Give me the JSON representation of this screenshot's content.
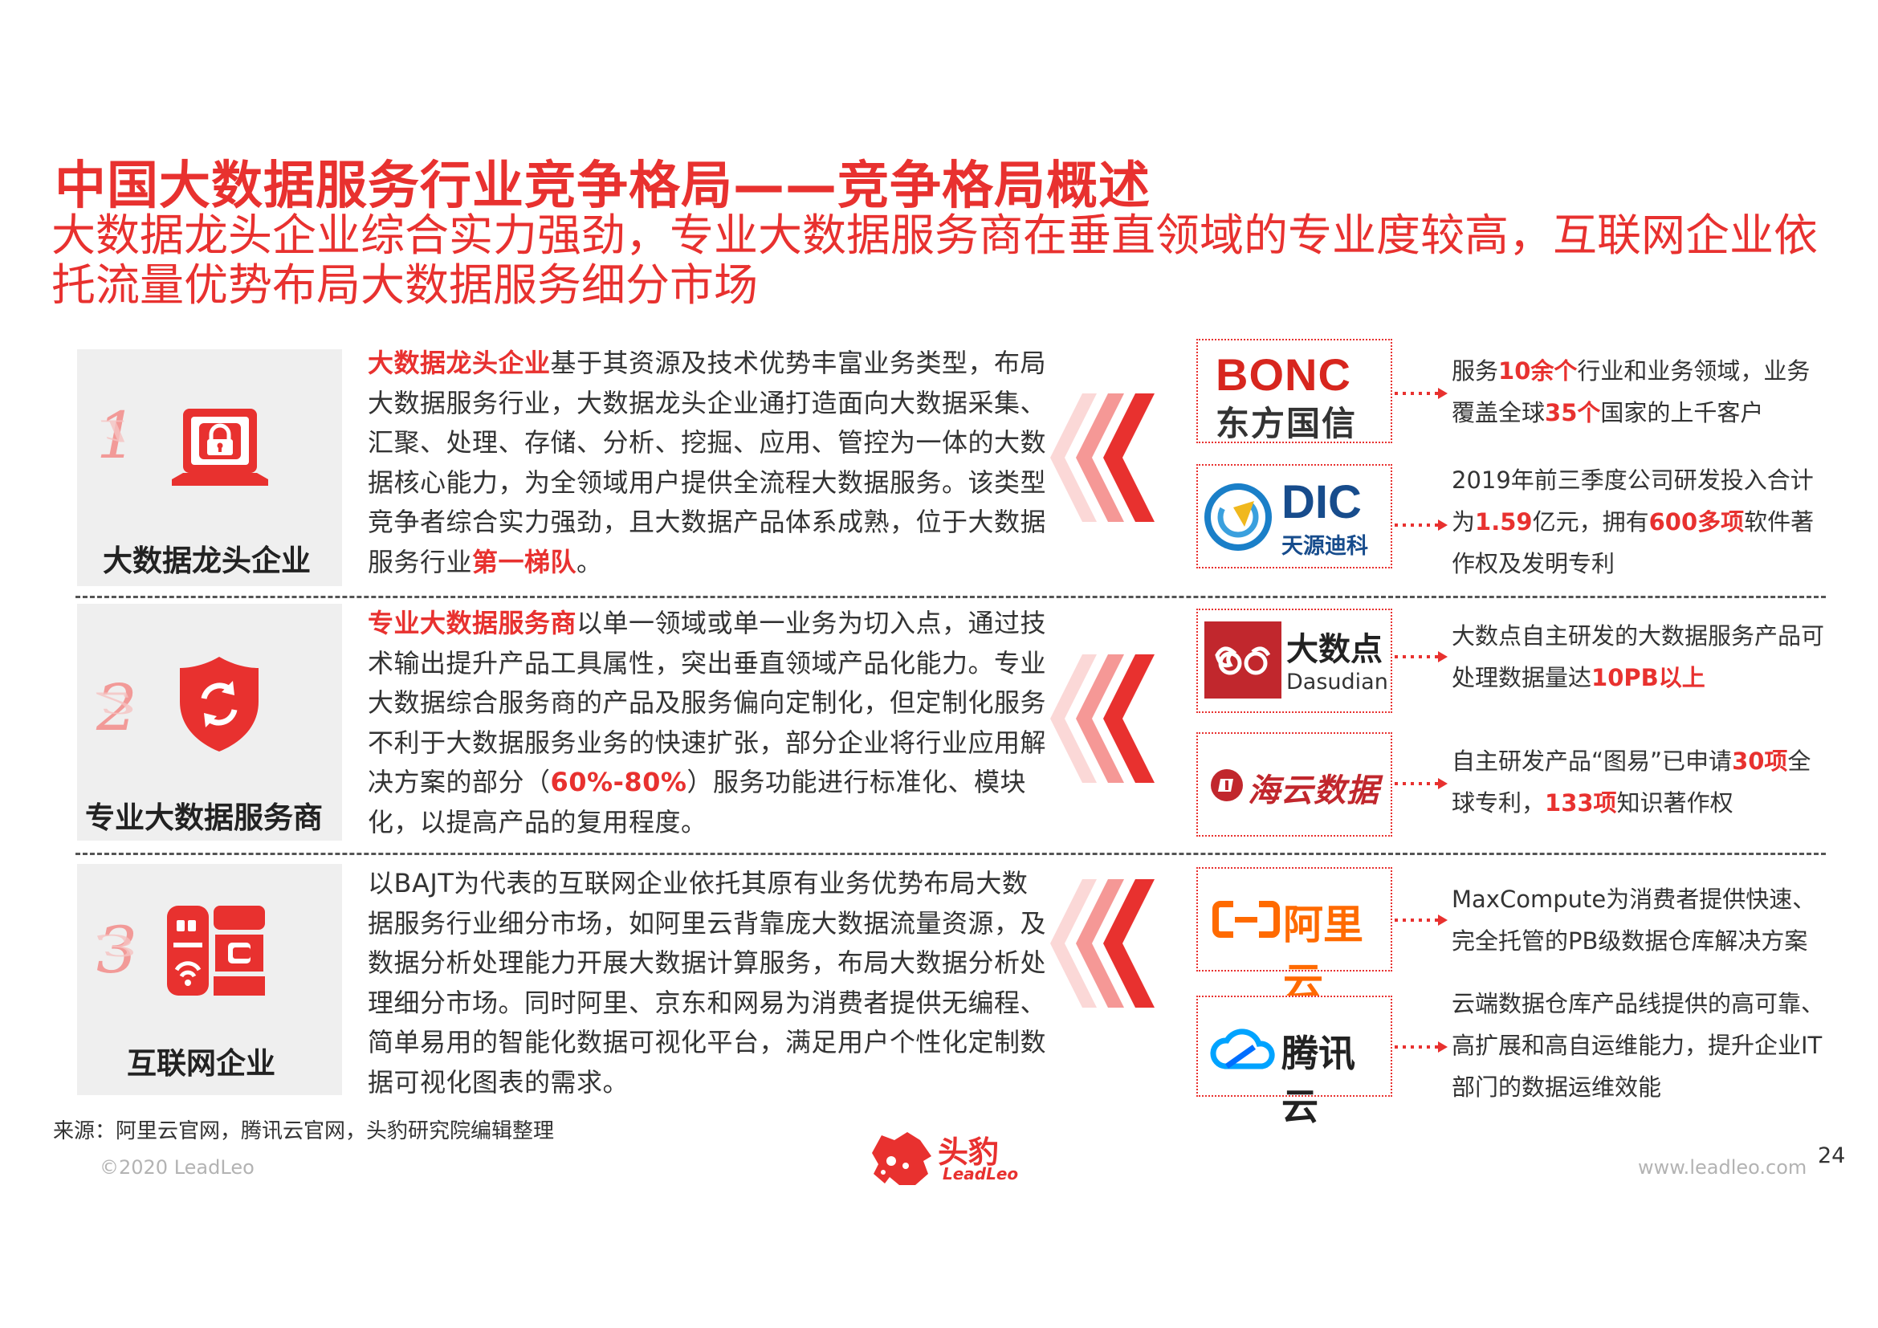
{
  "header": {
    "title": "中国大数据服务行业竞争格局——竞争格局概述",
    "subtitle": "大数据龙头企业综合实力强劲，专业大数据服务商在垂直领域的专业度较高，互联网企业依托流量优势布局大数据服务细分市场"
  },
  "colors": {
    "accent": "#e8312f",
    "panel": "#efefef",
    "muted": "#b3b3b3"
  },
  "sections": [
    {
      "number": "1",
      "icon": "laptop-lock-icon",
      "label": "大数据龙头企业",
      "desc": {
        "hl1": "大数据龙头企业",
        "t1": "基于其资源及技术优势丰富业务类型，布局大数据服务行业，大数据龙头企业通打造面向大数据采集、汇聚、处理、存储、分析、挖掘、应用、管控为一体的大数据核心能力，为全领域用户提供全流程大数据服务。该类型竞争者综合实力强劲，且大数据产品体系成熟，位于大数据服务行业",
        "hl2": "第一梯队",
        "t2": "。"
      },
      "companies": [
        {
          "logo_top": "BONC",
          "logo_bottom": "东方国信",
          "feature": {
            "a": "服务",
            "b": "10余个",
            "c": "行业和业务领域，业务覆盖全球",
            "d": "35个",
            "e": "国家的上千客户"
          }
        },
        {
          "logo_top": "DIC",
          "logo_bottom": "天源迪科",
          "feature": {
            "a": "2019年前三季度公司研发投入合计为",
            "b": "1.59",
            "c": "亿元，拥有",
            "d": "600多项",
            "e": "软件著作权及发明专利"
          }
        }
      ]
    },
    {
      "number": "2",
      "icon": "shield-sync-icon",
      "label": "专业大数据服务商",
      "desc": {
        "hl1": "专业大数据服务商",
        "t1": "以单一领域或单一业务为切入点，通过技术输出提升产品工具属性，突出垂直领域产品化能力。专业大数据综合服务商的产品及服务偏向定制化，但定制化服务不利于大数据服务业务的快速扩张，部分企业将行业应用解决方案的部分（",
        "hl2": "60%-80%",
        "t2": "）服务功能进行标准化、模块化，以提高产品的复用程度。"
      },
      "companies": [
        {
          "logo_top": "大数点",
          "logo_bottom": "Dasudian",
          "feature": {
            "a": "大数点自主研发的大数据服务产品可处理数据量达",
            "b": "10PB以上",
            "c": "",
            "d": "",
            "e": ""
          }
        },
        {
          "logo_top": "海云数据",
          "logo_bottom": "",
          "feature": {
            "a": "自主研发产品“图易”已申请",
            "b": "30项",
            "c": "全球专利，",
            "d": "133项",
            "e": "知识著作权"
          }
        }
      ]
    },
    {
      "number": "3",
      "icon": "server-wifi-icon",
      "label": "互联网企业",
      "desc": {
        "hl1": "",
        "t1": "以BAJT为代表的互联网企业依托其原有业务优势布局大数据服务行业细分市场，如阿里云背靠庞大数据流量资源，及数据分析处理能力开展大数据计算服务，布局大数据分析处理细分市场。同时阿里、京东和网易为消费者提供无编程、简单易用的智能化数据可视化平台，满足用户个性化定制数据可视化图表的需求。",
        "hl2": "",
        "t2": ""
      },
      "companies": [
        {
          "logo_top": "阿里云",
          "logo_bottom": "",
          "feature": {
            "a": "MaxCompute为消费者提供快速、完全托管的PB级数据仓库解决方案",
            "b": "",
            "c": "",
            "d": "",
            "e": ""
          }
        },
        {
          "logo_top": "腾讯云",
          "logo_bottom": "",
          "feature": {
            "a": "云端数据仓库产品线提供的高可靠、高扩展和高自运维能力，提升企业IT部门的数据运维效能",
            "b": "",
            "c": "",
            "d": "",
            "e": ""
          }
        }
      ]
    }
  ],
  "footer": {
    "source": "来源：阿里云官网，腾讯云官网，头豹研究院编辑整理",
    "copyright": "©2020 LeadLeo",
    "brand_cn": "头豹",
    "brand_en": "LeadLeo",
    "website": "www.leadleo.com",
    "page": "24"
  }
}
